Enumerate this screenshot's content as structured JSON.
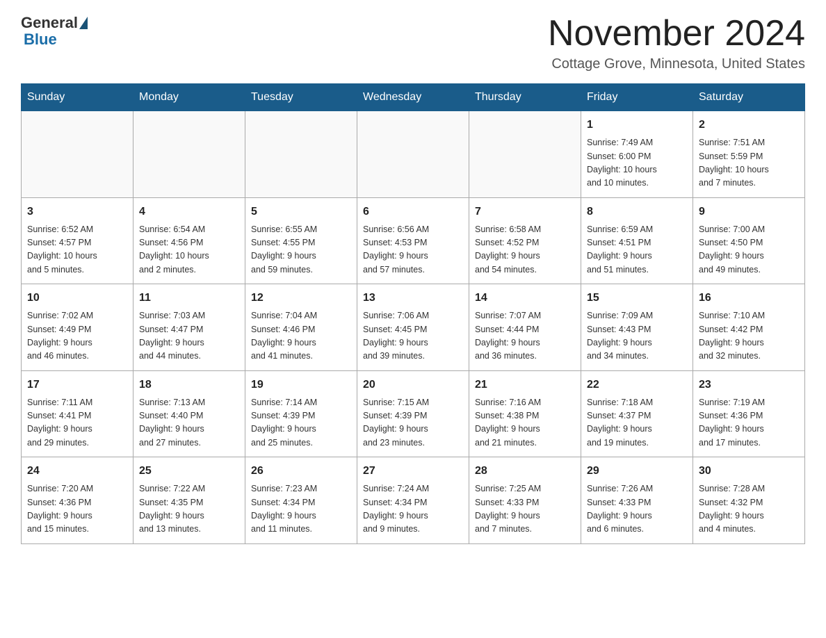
{
  "logo": {
    "general": "General",
    "blue": "Blue"
  },
  "title": "November 2024",
  "subtitle": "Cottage Grove, Minnesota, United States",
  "days_of_week": [
    "Sunday",
    "Monday",
    "Tuesday",
    "Wednesday",
    "Thursday",
    "Friday",
    "Saturday"
  ],
  "weeks": [
    [
      {
        "day": "",
        "info": ""
      },
      {
        "day": "",
        "info": ""
      },
      {
        "day": "",
        "info": ""
      },
      {
        "day": "",
        "info": ""
      },
      {
        "day": "",
        "info": ""
      },
      {
        "day": "1",
        "info": "Sunrise: 7:49 AM\nSunset: 6:00 PM\nDaylight: 10 hours\nand 10 minutes."
      },
      {
        "day": "2",
        "info": "Sunrise: 7:51 AM\nSunset: 5:59 PM\nDaylight: 10 hours\nand 7 minutes."
      }
    ],
    [
      {
        "day": "3",
        "info": "Sunrise: 6:52 AM\nSunset: 4:57 PM\nDaylight: 10 hours\nand 5 minutes."
      },
      {
        "day": "4",
        "info": "Sunrise: 6:54 AM\nSunset: 4:56 PM\nDaylight: 10 hours\nand 2 minutes."
      },
      {
        "day": "5",
        "info": "Sunrise: 6:55 AM\nSunset: 4:55 PM\nDaylight: 9 hours\nand 59 minutes."
      },
      {
        "day": "6",
        "info": "Sunrise: 6:56 AM\nSunset: 4:53 PM\nDaylight: 9 hours\nand 57 minutes."
      },
      {
        "day": "7",
        "info": "Sunrise: 6:58 AM\nSunset: 4:52 PM\nDaylight: 9 hours\nand 54 minutes."
      },
      {
        "day": "8",
        "info": "Sunrise: 6:59 AM\nSunset: 4:51 PM\nDaylight: 9 hours\nand 51 minutes."
      },
      {
        "day": "9",
        "info": "Sunrise: 7:00 AM\nSunset: 4:50 PM\nDaylight: 9 hours\nand 49 minutes."
      }
    ],
    [
      {
        "day": "10",
        "info": "Sunrise: 7:02 AM\nSunset: 4:49 PM\nDaylight: 9 hours\nand 46 minutes."
      },
      {
        "day": "11",
        "info": "Sunrise: 7:03 AM\nSunset: 4:47 PM\nDaylight: 9 hours\nand 44 minutes."
      },
      {
        "day": "12",
        "info": "Sunrise: 7:04 AM\nSunset: 4:46 PM\nDaylight: 9 hours\nand 41 minutes."
      },
      {
        "day": "13",
        "info": "Sunrise: 7:06 AM\nSunset: 4:45 PM\nDaylight: 9 hours\nand 39 minutes."
      },
      {
        "day": "14",
        "info": "Sunrise: 7:07 AM\nSunset: 4:44 PM\nDaylight: 9 hours\nand 36 minutes."
      },
      {
        "day": "15",
        "info": "Sunrise: 7:09 AM\nSunset: 4:43 PM\nDaylight: 9 hours\nand 34 minutes."
      },
      {
        "day": "16",
        "info": "Sunrise: 7:10 AM\nSunset: 4:42 PM\nDaylight: 9 hours\nand 32 minutes."
      }
    ],
    [
      {
        "day": "17",
        "info": "Sunrise: 7:11 AM\nSunset: 4:41 PM\nDaylight: 9 hours\nand 29 minutes."
      },
      {
        "day": "18",
        "info": "Sunrise: 7:13 AM\nSunset: 4:40 PM\nDaylight: 9 hours\nand 27 minutes."
      },
      {
        "day": "19",
        "info": "Sunrise: 7:14 AM\nSunset: 4:39 PM\nDaylight: 9 hours\nand 25 minutes."
      },
      {
        "day": "20",
        "info": "Sunrise: 7:15 AM\nSunset: 4:39 PM\nDaylight: 9 hours\nand 23 minutes."
      },
      {
        "day": "21",
        "info": "Sunrise: 7:16 AM\nSunset: 4:38 PM\nDaylight: 9 hours\nand 21 minutes."
      },
      {
        "day": "22",
        "info": "Sunrise: 7:18 AM\nSunset: 4:37 PM\nDaylight: 9 hours\nand 19 minutes."
      },
      {
        "day": "23",
        "info": "Sunrise: 7:19 AM\nSunset: 4:36 PM\nDaylight: 9 hours\nand 17 minutes."
      }
    ],
    [
      {
        "day": "24",
        "info": "Sunrise: 7:20 AM\nSunset: 4:36 PM\nDaylight: 9 hours\nand 15 minutes."
      },
      {
        "day": "25",
        "info": "Sunrise: 7:22 AM\nSunset: 4:35 PM\nDaylight: 9 hours\nand 13 minutes."
      },
      {
        "day": "26",
        "info": "Sunrise: 7:23 AM\nSunset: 4:34 PM\nDaylight: 9 hours\nand 11 minutes."
      },
      {
        "day": "27",
        "info": "Sunrise: 7:24 AM\nSunset: 4:34 PM\nDaylight: 9 hours\nand 9 minutes."
      },
      {
        "day": "28",
        "info": "Sunrise: 7:25 AM\nSunset: 4:33 PM\nDaylight: 9 hours\nand 7 minutes."
      },
      {
        "day": "29",
        "info": "Sunrise: 7:26 AM\nSunset: 4:33 PM\nDaylight: 9 hours\nand 6 minutes."
      },
      {
        "day": "30",
        "info": "Sunrise: 7:28 AM\nSunset: 4:32 PM\nDaylight: 9 hours\nand 4 minutes."
      }
    ]
  ]
}
